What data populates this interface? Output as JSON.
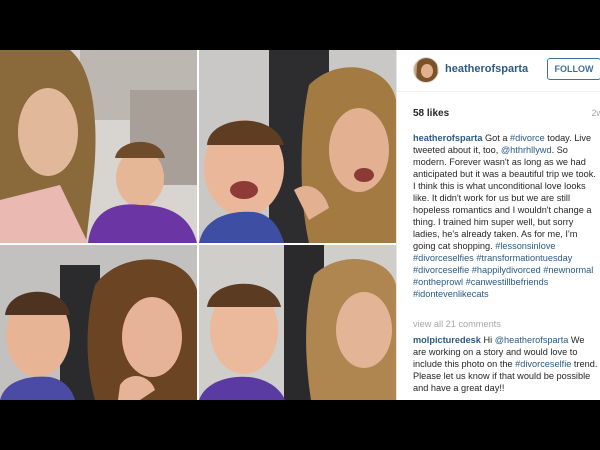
{
  "post": {
    "username": "heatherofsparta",
    "follow_label": "FOLLOW",
    "likes": "58 likes",
    "age": "2w",
    "caption": {
      "author": "heatherofsparta",
      "t1": " Got a ",
      "tag_divorce": "#divorce",
      "t2": " today. Live tweeted about it, too, ",
      "mention": "@hthrhllywd",
      "t3": ". So modern. Forever wasn't as long as we had anticipated but it was a beautiful trip we took. I think this is what unconditional love looks like. It didn't work for us but we are still hopeless romantics and I wouldn't change a thing. I trained him super well, but sorry ladies, he's already taken. As for me, I'm going cat shopping. ",
      "tags": [
        "#lessonsinlove",
        "#divorceselfies",
        "#transformationtuesday",
        "#divorceselfie",
        "#happilydivorced",
        "#newnormal",
        "#ontheprowl",
        "#canwestillbefriends",
        "#idontevenlikecats"
      ]
    },
    "view_all": "view all 21 comments",
    "comment": {
      "author": "molpicturedesk",
      "t1": " Hi ",
      "mention": "@heatherofsparta",
      "t2": " We are working on a story and would love to include this photo on the ",
      "tag": "#divorceselfie",
      "t3": " trend. Please let us know if that would be possible and have a great day!!"
    }
  },
  "photos": [
    {
      "name": "selfie-photo-1"
    },
    {
      "name": "selfie-photo-2"
    },
    {
      "name": "selfie-photo-3"
    },
    {
      "name": "selfie-photo-4"
    }
  ]
}
